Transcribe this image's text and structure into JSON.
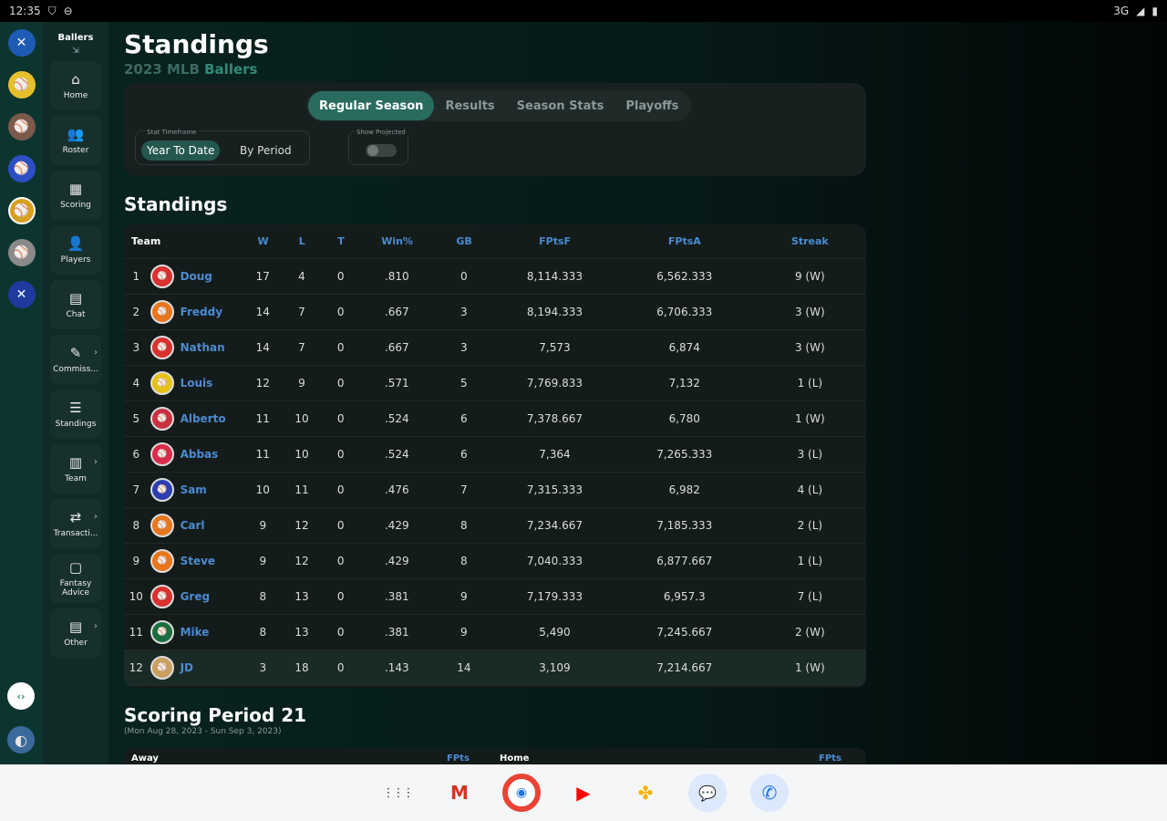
{
  "status": {
    "time": "12:35",
    "network": "3G"
  },
  "rail_bottom_icon": "code-icon",
  "nav": {
    "league_name": "Ballers",
    "items": [
      {
        "label": "Home",
        "icon": "⌂"
      },
      {
        "label": "Roster",
        "icon": "👥"
      },
      {
        "label": "Scoring",
        "icon": "▦"
      },
      {
        "label": "Players",
        "icon": "👤"
      },
      {
        "label": "Chat",
        "icon": "▤"
      },
      {
        "label": "Commiss...",
        "icon": "✎",
        "chev": "›"
      },
      {
        "label": "Standings",
        "icon": "☰"
      },
      {
        "label": "Team",
        "icon": "▥",
        "chev": "›"
      },
      {
        "label": "Transacti...",
        "icon": "⇄",
        "chev": "›"
      },
      {
        "label": "Fantasy Advice",
        "icon": "▢"
      },
      {
        "label": "Other",
        "icon": "▤",
        "chev": "›"
      }
    ]
  },
  "header": {
    "title": "Standings",
    "subtitle_prefix": "2023 MLB",
    "subtitle_league": "Ballers"
  },
  "tabs": [
    "Regular Season",
    "Results",
    "Season Stats",
    "Playoffs"
  ],
  "filters": {
    "timeframe_label": "Stat Timeframe",
    "option_ytd": "Year To Date",
    "option_period": "By Period",
    "projected_label": "Show Projected"
  },
  "standings_title": "Standings",
  "columns": {
    "team": "Team",
    "w": "W",
    "l": "L",
    "t": "T",
    "pct": "Win%",
    "gb": "GB",
    "fptsf": "FPtsF",
    "fptsa": "FPtsA",
    "streak": "Streak"
  },
  "rows": [
    {
      "rank": "1",
      "team": "Doug",
      "w": "17",
      "l": "4",
      "t": "0",
      "pct": ".810",
      "gb": "0",
      "fptsf": "8,114.333",
      "fptsa": "6,562.333",
      "streak": "9 (W)",
      "color": "#d93030"
    },
    {
      "rank": "2",
      "team": "Freddy",
      "w": "14",
      "l": "7",
      "t": "0",
      "pct": ".667",
      "gb": "3",
      "fptsf": "8,194.333",
      "fptsa": "6,706.333",
      "streak": "3 (W)",
      "color": "#e8761d"
    },
    {
      "rank": "3",
      "team": "Nathan",
      "w": "14",
      "l": "7",
      "t": "0",
      "pct": ".667",
      "gb": "3",
      "fptsf": "7,573",
      "fptsa": "6,874",
      "streak": "3 (W)",
      "color": "#d93030"
    },
    {
      "rank": "4",
      "team": "Louis",
      "w": "12",
      "l": "9",
      "t": "0",
      "pct": ".571",
      "gb": "5",
      "fptsf": "7,769.833",
      "fptsa": "7,132",
      "streak": "1 (L)",
      "color": "#e5c21a"
    },
    {
      "rank": "5",
      "team": "Alberto",
      "w": "11",
      "l": "10",
      "t": "0",
      "pct": ".524",
      "gb": "6",
      "fptsf": "7,378.667",
      "fptsa": "6,780",
      "streak": "1 (W)",
      "color": "#c93040"
    },
    {
      "rank": "6",
      "team": "Abbas",
      "w": "11",
      "l": "10",
      "t": "0",
      "pct": ".524",
      "gb": "6",
      "fptsf": "7,364",
      "fptsa": "7,265.333",
      "streak": "3 (L)",
      "color": "#d92c4a"
    },
    {
      "rank": "7",
      "team": "Sam",
      "w": "10",
      "l": "11",
      "t": "0",
      "pct": ".476",
      "gb": "7",
      "fptsf": "7,315.333",
      "fptsa": "6,982",
      "streak": "4 (L)",
      "color": "#2b3fb0"
    },
    {
      "rank": "8",
      "team": "Carl",
      "w": "9",
      "l": "12",
      "t": "0",
      "pct": ".429",
      "gb": "8",
      "fptsf": "7,234.667",
      "fptsa": "7,185.333",
      "streak": "2 (L)",
      "color": "#e8761d"
    },
    {
      "rank": "9",
      "team": "Steve",
      "w": "9",
      "l": "12",
      "t": "0",
      "pct": ".429",
      "gb": "8",
      "fptsf": "7,040.333",
      "fptsa": "6,877.667",
      "streak": "1 (L)",
      "color": "#e8761d"
    },
    {
      "rank": "10",
      "team": "Greg",
      "w": "8",
      "l": "13",
      "t": "0",
      "pct": ".381",
      "gb": "9",
      "fptsf": "7,179.333",
      "fptsa": "6,957.3",
      "streak": "7 (L)",
      "color": "#d93030"
    },
    {
      "rank": "11",
      "team": "Mike",
      "w": "8",
      "l": "13",
      "t": "0",
      "pct": ".381",
      "gb": "9",
      "fptsf": "5,490",
      "fptsa": "7,245.667",
      "streak": "2 (W)",
      "color": "#1d6e3f"
    },
    {
      "rank": "12",
      "team": "JD",
      "w": "3",
      "l": "18",
      "t": "0",
      "pct": ".143",
      "gb": "14",
      "fptsf": "3,109",
      "fptsa": "7,214.667",
      "streak": "1 (W)",
      "color": "#c9a060"
    }
  ],
  "scoring_period": {
    "title": "Scoring Period 21",
    "dates": "(Mon Aug 28, 2023 - Sun Sep 3, 2023)",
    "away_label": "Away",
    "home_label": "Home",
    "fpts_label": "FPts"
  },
  "dock": [
    {
      "name": "apps-grid-icon",
      "glyph": "⋮⋮⋮"
    },
    {
      "name": "gmail-icon",
      "glyph": "M"
    },
    {
      "name": "chrome-icon",
      "glyph": "◉"
    },
    {
      "name": "youtube-icon",
      "glyph": "▶"
    },
    {
      "name": "photos-icon",
      "glyph": "✤"
    },
    {
      "name": "messages-icon",
      "glyph": "💬"
    },
    {
      "name": "phone-icon",
      "glyph": "✆"
    }
  ]
}
